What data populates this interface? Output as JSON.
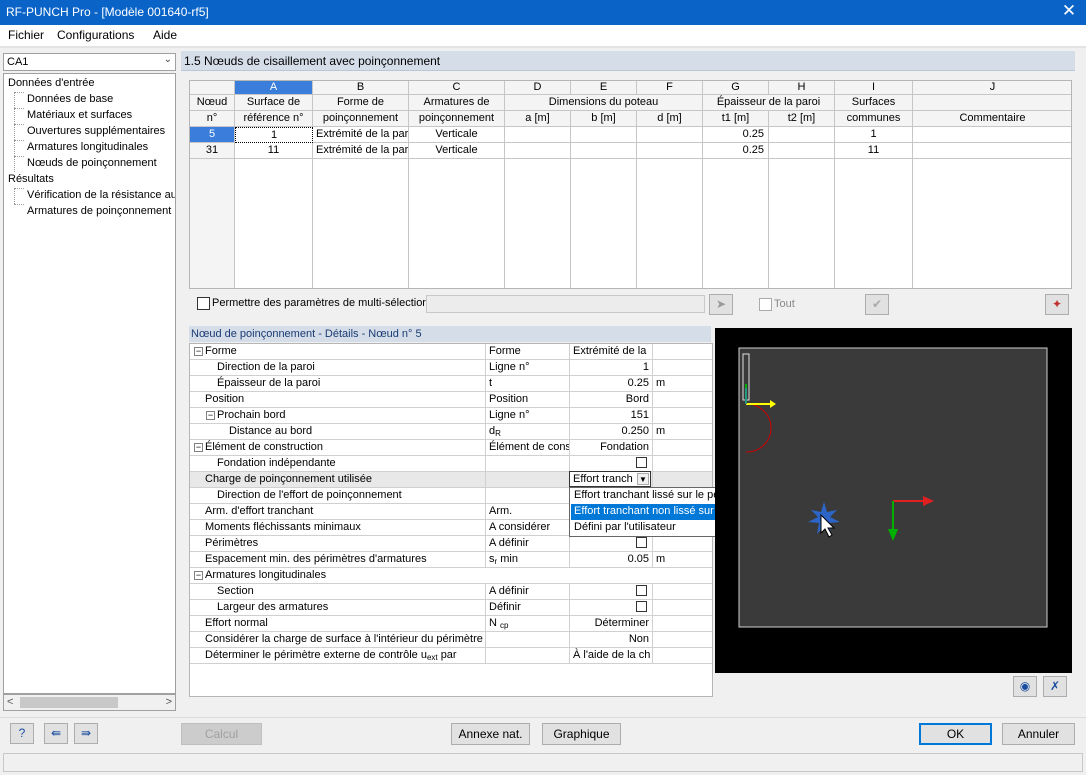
{
  "window": {
    "title": "RF-PUNCH Pro - [Modèle 001640-rf5]",
    "close": "✕"
  },
  "menu": [
    "Fichier",
    "Configurations",
    "Aide"
  ],
  "case_select": {
    "value": "CA1"
  },
  "nav": {
    "input_header": "Données d'entrée",
    "input_items": [
      "Données de base",
      "Matériaux et surfaces",
      "Ouvertures supplémentaires",
      "Armatures longitudinales",
      "Nœuds de poinçonnement"
    ],
    "results_header": "Résultats",
    "result_items": [
      "Vérification de la résistance au",
      "Armatures de poinçonnement r"
    ]
  },
  "section_title": "1.5  Nœuds de cisaillement avec poinçonnement",
  "grid": {
    "letters": [
      "A",
      "B",
      "C",
      "D",
      "E",
      "F",
      "G",
      "H",
      "I",
      "J"
    ],
    "corner": [
      "Nœud",
      "n°"
    ],
    "head": {
      "a": [
        "Surface de",
        "référence n°"
      ],
      "b": [
        "Forme de",
        "poinçonnement"
      ],
      "c": [
        "Armatures de",
        "poinçonnement"
      ],
      "def": "Dimensions du poteau",
      "d": "a [m]",
      "e": "b [m]",
      "f": "d [m]",
      "gh": "Épaisseur de la paroi",
      "g": "t1 [m]",
      "h": "t2 [m]",
      "i": [
        "Surfaces",
        "communes"
      ],
      "j": "Commentaire"
    },
    "rows": [
      {
        "node": "5",
        "ref": "1",
        "forme": "Extrémité de la par",
        "arm": "Verticale",
        "t1": "0.25",
        "surf": "1"
      },
      {
        "node": "31",
        "ref": "11",
        "forme": "Extrémité de la par",
        "arm": "Verticale",
        "t1": "0.25",
        "surf": "11"
      }
    ]
  },
  "multi": {
    "label": "Permettre des paramètres de multi-sélectior",
    "tout": "Tout"
  },
  "details": {
    "title": "Nœud de poinçonnement - Détails - Nœud n° 5",
    "rows": [
      {
        "label": "Forme",
        "sym": "Forme",
        "val": "Extrémité de la",
        "unit": ""
      },
      {
        "label": "Direction de la paroi",
        "sym": "Ligne n°",
        "val": "1",
        "unit": ""
      },
      {
        "label": "Épaisseur de la paroi",
        "sym": "t",
        "val": "0.25",
        "unit": "m"
      },
      {
        "label": "Position",
        "sym": "Position",
        "val": "Bord",
        "unit": ""
      },
      {
        "label": "Prochain bord",
        "sym": "Ligne n°",
        "val": "151",
        "unit": ""
      },
      {
        "label": "Distance au bord",
        "sym": "d",
        "sub": "R",
        "val": "0.250",
        "unit": "m"
      },
      {
        "label": "Élément de construction",
        "sym": "Élément de cons",
        "val": "Fondation",
        "unit": ""
      },
      {
        "label": "Fondation indépendante",
        "sym": "",
        "val": "",
        "unit": ""
      },
      {
        "label": "Charge de poinçonnement utilisée",
        "sym": "",
        "val": "",
        "unit": ""
      },
      {
        "label": "Direction de l'effort de poinçonnement",
        "sym": "",
        "val": "",
        "unit": ""
      },
      {
        "label": "Arm. d'effort tranchant",
        "sym": "Arm.",
        "val": "",
        "unit": ""
      },
      {
        "label": "Moments fléchissants minimaux",
        "sym": "A considérer",
        "val": "",
        "unit": ""
      },
      {
        "label": "Périmètres",
        "sym": "A définir",
        "val": "",
        "unit": ""
      },
      {
        "label": "Espacement min. des périmètres d'armatures",
        "sym": "s",
        "sub": "r",
        "sym2": "min",
        "val": "0.05",
        "unit": "m"
      },
      {
        "label": "Armatures longitudinales",
        "sym": "",
        "val": "",
        "unit": ""
      },
      {
        "label": "Section",
        "sym": "A définir",
        "val": "",
        "unit": ""
      },
      {
        "label": "Largeur des armatures",
        "sym": "Définir",
        "val": "",
        "unit": ""
      },
      {
        "label": "Effort normal",
        "sym": "N",
        "sub": "cp",
        "val": "Déterminer",
        "unit": ""
      },
      {
        "label": "Considérer la charge de surface à l'intérieur du périmètre cr",
        "sym": "",
        "val": "Non",
        "unit": ""
      },
      {
        "label": "Déterminer le périmètre externe de contrôle u",
        "labelsub": "ext",
        "label2": "par",
        "sym": "",
        "val": "À l'aide de la ch",
        "unit": ""
      }
    ]
  },
  "dropdown": {
    "selected": "Effort tranch",
    "options": [
      "Effort tranchant lissé sur le périmètre critique",
      "Effort tranchant non lissé sur le périmètre critique",
      "Défini par l'utilisateur"
    ],
    "highlighted_index": 1
  },
  "preview": {
    "axis_colors": {
      "x": "#ff0000",
      "y": "#00b000",
      "z": "#ffff00"
    }
  },
  "buttons": {
    "calcul": "Calcul",
    "annexe": "Annexe nat.",
    "graphique": "Graphique",
    "ok": "OK",
    "annuler": "Annuler"
  },
  "icons": {
    "help": "help-icon",
    "prev": "previous-icon",
    "next": "next-icon"
  }
}
